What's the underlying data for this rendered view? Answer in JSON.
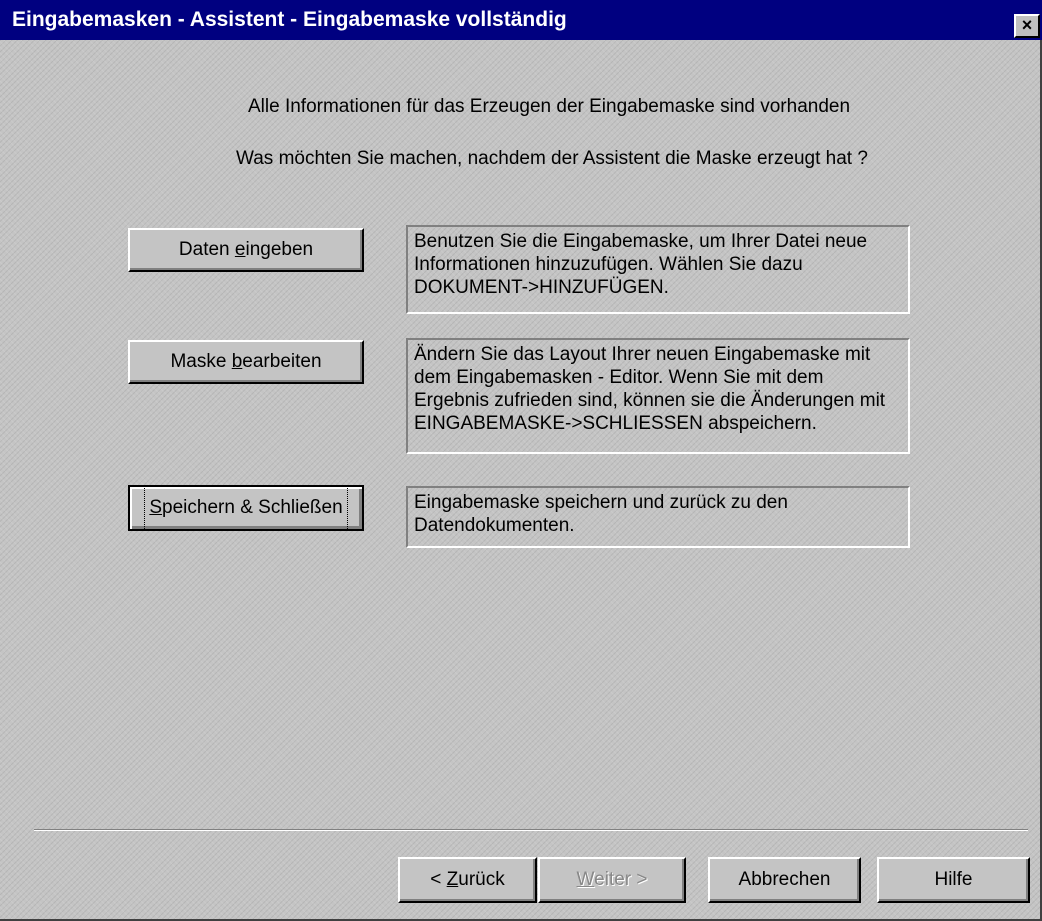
{
  "window": {
    "title": "Eingabemasken - Assistent - Eingabemaske vollständig",
    "close_symbol": "×"
  },
  "info": {
    "line1": "Alle Informationen für das Erzeugen der Eingabemaske sind vorhanden",
    "line2": "Was möchten Sie machen, nachdem der Assistent die Maske erzeugt hat ?"
  },
  "options": [
    {
      "label_before": "Daten ",
      "label_mnemonic": "e",
      "label_after": "ingeben",
      "description": "Benutzen Sie die Eingabemaske, um Ihrer Datei neue Informationen hinzuzufügen.  Wählen Sie dazu DOKUMENT->HINZUFÜGEN."
    },
    {
      "label_before": "Maske ",
      "label_mnemonic": "b",
      "label_after": "earbeiten",
      "description": "Ändern Sie das Layout Ihrer neuen Eingabemaske mit dem Eingabemasken - Editor. Wenn Sie mit dem Ergebnis zufrieden sind, können sie die Änderungen mit EINGABEMASKE->SCHLIESSEN abspeichern."
    },
    {
      "label_before": "",
      "label_mnemonic": "S",
      "label_after": "peichern & Schließen",
      "description": "Eingabemaske speichern und zurück zu den Datendokumenten."
    }
  ],
  "footer": {
    "back_prefix": "< ",
    "back_mnemonic": "Z",
    "back_rest": "urück",
    "next_mnemonic": "W",
    "next_rest": "eiter >",
    "cancel_label": "Abbrechen",
    "help_label": "Hilfe"
  }
}
